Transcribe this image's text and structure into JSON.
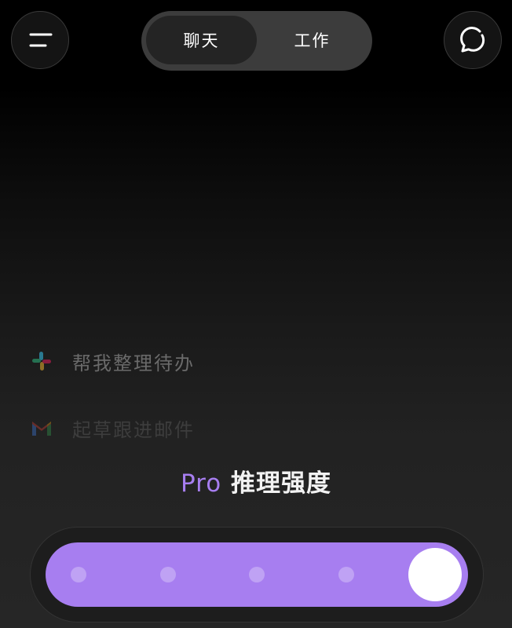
{
  "header": {
    "menu_icon": "menu-icon",
    "refresh_icon": "chat-refresh-icon",
    "tabs": [
      {
        "label": "聊天",
        "active": true
      },
      {
        "label": "工作",
        "active": false
      }
    ]
  },
  "suggestions": [
    {
      "icon": "slack-icon",
      "label": "帮我整理待办"
    },
    {
      "icon": "gmail-icon",
      "label": "起草跟进邮件"
    }
  ],
  "reasoning": {
    "prefix": "Pro",
    "title": "推理强度",
    "accent_color": "#a77ef0",
    "slider": {
      "steps": 5,
      "selected_step": 5
    }
  }
}
